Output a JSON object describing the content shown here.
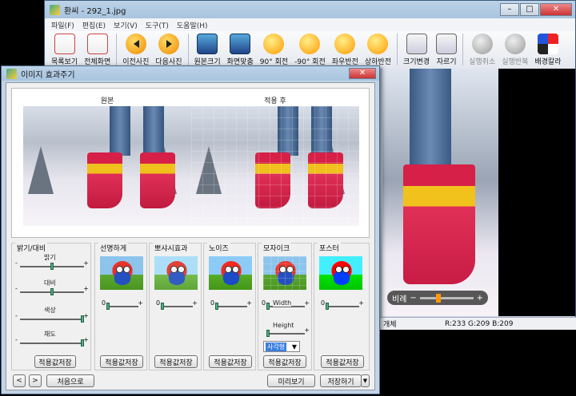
{
  "main_window": {
    "title": "환씨 - 292_1.jpg",
    "controls": {
      "minimize": "–",
      "maximize": "□",
      "close": "✕"
    },
    "menu": [
      "파일(F)",
      "편집(E)",
      "보기(V)",
      "도구(T)",
      "도움말(H)"
    ],
    "toolbar": [
      {
        "label": "목록보기",
        "icon": "list-view-icon",
        "enabled": true
      },
      {
        "label": "전체화면",
        "icon": "fullscreen-icon",
        "enabled": true
      },
      {
        "label": "이전사진",
        "icon": "prev-arrow-icon",
        "enabled": true
      },
      {
        "label": "다음사진",
        "icon": "next-arrow-icon",
        "enabled": true
      },
      {
        "label": "원본크기",
        "icon": "original-size-icon",
        "enabled": true
      },
      {
        "label": "화면맞춤",
        "icon": "fit-screen-icon",
        "enabled": true
      },
      {
        "label": "90° 회전",
        "icon": "rotate-90-icon",
        "enabled": true
      },
      {
        "label": "-90° 회전",
        "icon": "rotate-minus-90-icon",
        "enabled": true
      },
      {
        "label": "좌우반전",
        "icon": "flip-horizontal-icon",
        "enabled": true
      },
      {
        "label": "상하반전",
        "icon": "flip-vertical-icon",
        "enabled": true
      },
      {
        "label": "크기변경",
        "icon": "resize-icon",
        "enabled": true
      },
      {
        "label": "자르기",
        "icon": "crop-icon",
        "enabled": true
      },
      {
        "label": "실행취소",
        "icon": "undo-icon",
        "enabled": false
      },
      {
        "label": "실행반복",
        "icon": "redo-icon",
        "enabled": false
      },
      {
        "label": "배경칼라",
        "icon": "background-color-icon",
        "enabled": true
      }
    ],
    "zoom": {
      "label": "비례",
      "minus": "−",
      "plus": "+"
    },
    "status": {
      "count": "개체",
      "rgb": "R:233 G:209 B:209"
    }
  },
  "effects_dialog": {
    "title": "이미지 효과주기",
    "close": "✕",
    "preview": {
      "original_label": "원본",
      "applied_label": "적용 후"
    },
    "brightness_group": {
      "title": "밝기/대비",
      "sliders": [
        {
          "label": "밝기",
          "value": 0.5
        },
        {
          "label": "대비",
          "value": 0.5
        },
        {
          "label": "색상",
          "value": 1.0
        },
        {
          "label": "채도",
          "value": 1.0
        }
      ],
      "save_button": "적용값저장"
    },
    "effects": [
      {
        "title": "선명하게",
        "value": "0",
        "save_button": "적용값저장"
      },
      {
        "title": "뽀샤시효과",
        "value": "0",
        "save_button": "적용값저장"
      },
      {
        "title": "노이즈",
        "value": "0",
        "save_button": "적용값저장"
      },
      {
        "title": "모자이크",
        "value": "0",
        "width_label": "Width",
        "height_label": "Height",
        "shape": "사각형",
        "save_button": "적용값저장"
      },
      {
        "title": "포스터",
        "value": "0",
        "save_button": "적용값저장"
      }
    ],
    "slider_min": "-",
    "slider_max": "+",
    "footer": {
      "prev": "<",
      "next": ">",
      "reset": "처음으로",
      "preview": "미리보기",
      "save": "저장하기",
      "save_dropdown": "▼"
    }
  }
}
